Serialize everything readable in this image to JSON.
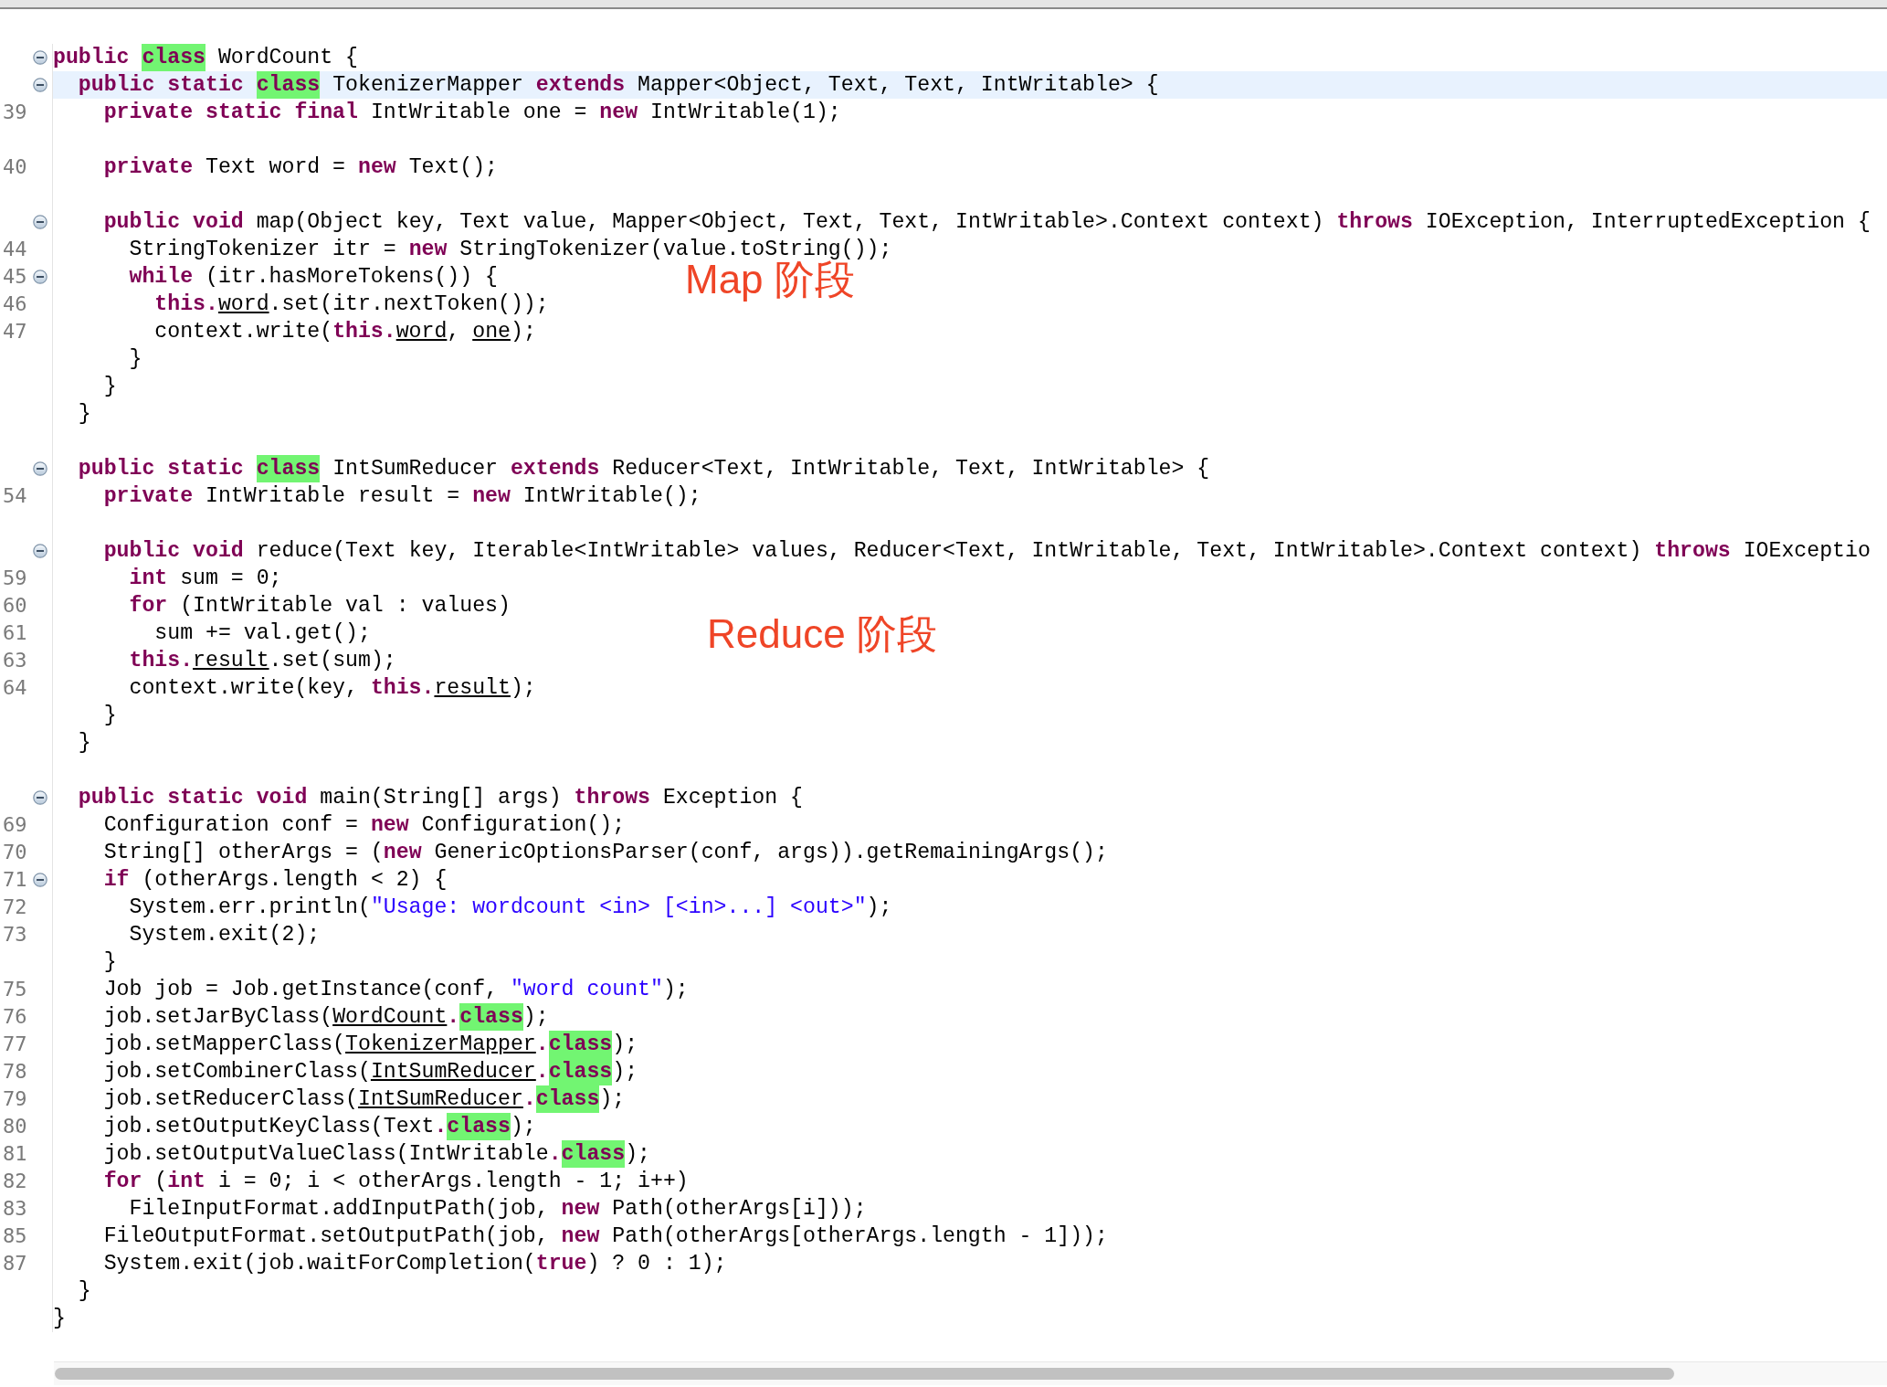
{
  "editor": {
    "lines": [
      {
        "kind": "code",
        "folding": true,
        "current": false,
        "tokens": [
          {
            "kind": "keyword",
            "text": "public "
          },
          {
            "kind": "match",
            "text": "class"
          },
          {
            "kind": "plain",
            "text": " WordCount {"
          }
        ]
      },
      {
        "kind": "code",
        "folding": true,
        "current": true,
        "tokens": [
          {
            "kind": "keyword",
            "text": "  public static "
          },
          {
            "kind": "match",
            "text": "class"
          },
          {
            "kind": "plain",
            "text": " TokenizerMapper "
          },
          {
            "kind": "keyword",
            "text": "extends"
          },
          {
            "kind": "plain",
            "text": " Mapper<Object, Text, Text, IntWritable> {"
          }
        ]
      },
      {
        "kind": "code",
        "number": "39",
        "folding": false,
        "current": false,
        "tokens": [
          {
            "kind": "keyword",
            "text": "    private static final"
          },
          {
            "kind": "plain",
            "text": " IntWritable one = "
          },
          {
            "kind": "keyword",
            "text": "new"
          },
          {
            "kind": "plain",
            "text": " IntWritable(1);"
          }
        ]
      },
      {
        "kind": "blank"
      },
      {
        "kind": "code",
        "number": "40",
        "folding": false,
        "current": false,
        "tokens": [
          {
            "kind": "keyword",
            "text": "    private"
          },
          {
            "kind": "plain",
            "text": " Text word = "
          },
          {
            "kind": "keyword",
            "text": "new"
          },
          {
            "kind": "plain",
            "text": " Text();"
          }
        ]
      },
      {
        "kind": "blank"
      },
      {
        "kind": "code",
        "folding": true,
        "current": false,
        "tokens": [
          {
            "kind": "keyword",
            "text": "    public void"
          },
          {
            "kind": "plain",
            "text": " map(Object key, Text value, Mapper<Object, Text, Text, IntWritable>.Context context) "
          },
          {
            "kind": "keyword",
            "text": "throws"
          },
          {
            "kind": "plain",
            "text": " IOException, InterruptedException {"
          }
        ]
      },
      {
        "kind": "code",
        "number": "44",
        "folding": false,
        "current": false,
        "tokens": [
          {
            "kind": "plain",
            "text": "      StringTokenizer itr = "
          },
          {
            "kind": "keyword",
            "text": "new"
          },
          {
            "kind": "plain",
            "text": " StringTokenizer(value.toString());"
          }
        ]
      },
      {
        "kind": "code",
        "number": "45",
        "folding": true,
        "current": false,
        "tokens": [
          {
            "kind": "keyword",
            "text": "      while"
          },
          {
            "kind": "plain",
            "text": " (itr.hasMoreTokens()) {"
          }
        ]
      },
      {
        "kind": "code",
        "number": "46",
        "folding": false,
        "current": false,
        "tokens": [
          {
            "kind": "keyword",
            "text": "        this."
          },
          {
            "kind": "ref",
            "text": "word"
          },
          {
            "kind": "plain",
            "text": ".set(itr.nextToken());"
          }
        ]
      },
      {
        "kind": "code",
        "number": "47",
        "folding": false,
        "current": false,
        "tokens": [
          {
            "kind": "plain",
            "text": "        context.write("
          },
          {
            "kind": "keyword",
            "text": "this."
          },
          {
            "kind": "ref",
            "text": "word"
          },
          {
            "kind": "plain",
            "text": ", "
          },
          {
            "kind": "ref",
            "text": "one"
          },
          {
            "kind": "plain",
            "text": ");"
          }
        ]
      },
      {
        "kind": "code",
        "folding": false,
        "current": false,
        "tokens": [
          {
            "kind": "plain",
            "text": "      }"
          }
        ]
      },
      {
        "kind": "code",
        "folding": false,
        "current": false,
        "tokens": [
          {
            "kind": "plain",
            "text": "    }"
          }
        ]
      },
      {
        "kind": "code",
        "folding": false,
        "current": false,
        "tokens": [
          {
            "kind": "plain",
            "text": "  }"
          }
        ]
      },
      {
        "kind": "blank"
      },
      {
        "kind": "code",
        "folding": true,
        "current": false,
        "tokens": [
          {
            "kind": "keyword",
            "text": "  public static "
          },
          {
            "kind": "match",
            "text": "class"
          },
          {
            "kind": "plain",
            "text": " IntSumReducer "
          },
          {
            "kind": "keyword",
            "text": "extends"
          },
          {
            "kind": "plain",
            "text": " Reducer<Text, IntWritable, Text, IntWritable> {"
          }
        ]
      },
      {
        "kind": "code",
        "number": "54",
        "folding": false,
        "current": false,
        "tokens": [
          {
            "kind": "keyword",
            "text": "    private"
          },
          {
            "kind": "plain",
            "text": " IntWritable result = "
          },
          {
            "kind": "keyword",
            "text": "new"
          },
          {
            "kind": "plain",
            "text": " IntWritable();"
          }
        ]
      },
      {
        "kind": "blank"
      },
      {
        "kind": "code",
        "folding": true,
        "current": false,
        "tokens": [
          {
            "kind": "keyword",
            "text": "    public void"
          },
          {
            "kind": "plain",
            "text": " reduce(Text key, Iterable<IntWritable> values, Reducer<Text, IntWritable, Text, IntWritable>.Context context) "
          },
          {
            "kind": "keyword",
            "text": "throws"
          },
          {
            "kind": "plain",
            "text": " IOExceptio"
          }
        ]
      },
      {
        "kind": "code",
        "number": "59",
        "folding": false,
        "current": false,
        "tokens": [
          {
            "kind": "keyword",
            "text": "      int"
          },
          {
            "kind": "plain",
            "text": " sum = 0;"
          }
        ]
      },
      {
        "kind": "code",
        "number": "60",
        "folding": false,
        "current": false,
        "tokens": [
          {
            "kind": "keyword",
            "text": "      for"
          },
          {
            "kind": "plain",
            "text": " (IntWritable val : values)"
          }
        ]
      },
      {
        "kind": "code",
        "number": "61",
        "folding": false,
        "current": false,
        "tokens": [
          {
            "kind": "plain",
            "text": "        sum += val.get();"
          }
        ]
      },
      {
        "kind": "code",
        "number": "63",
        "folding": false,
        "current": false,
        "tokens": [
          {
            "kind": "keyword",
            "text": "      this."
          },
          {
            "kind": "ref",
            "text": "result"
          },
          {
            "kind": "plain",
            "text": ".set(sum);"
          }
        ]
      },
      {
        "kind": "code",
        "number": "64",
        "folding": false,
        "current": false,
        "tokens": [
          {
            "kind": "plain",
            "text": "      context.write(key, "
          },
          {
            "kind": "keyword",
            "text": "this."
          },
          {
            "kind": "ref",
            "text": "result"
          },
          {
            "kind": "plain",
            "text": ");"
          }
        ]
      },
      {
        "kind": "code",
        "folding": false,
        "current": false,
        "tokens": [
          {
            "kind": "plain",
            "text": "    }"
          }
        ]
      },
      {
        "kind": "code",
        "folding": false,
        "current": false,
        "tokens": [
          {
            "kind": "plain",
            "text": "  }"
          }
        ]
      },
      {
        "kind": "blank"
      },
      {
        "kind": "code",
        "folding": true,
        "current": false,
        "tokens": [
          {
            "kind": "keyword",
            "text": "  public static void"
          },
          {
            "kind": "plain",
            "text": " main(String[] args) "
          },
          {
            "kind": "keyword",
            "text": "throws"
          },
          {
            "kind": "plain",
            "text": " Exception {"
          }
        ]
      },
      {
        "kind": "code",
        "number": "69",
        "folding": false,
        "current": false,
        "tokens": [
          {
            "kind": "plain",
            "text": "    Configuration conf = "
          },
          {
            "kind": "keyword",
            "text": "new"
          },
          {
            "kind": "plain",
            "text": " Configuration();"
          }
        ]
      },
      {
        "kind": "code",
        "number": "70",
        "folding": false,
        "current": false,
        "tokens": [
          {
            "kind": "plain",
            "text": "    String[] otherArgs = ("
          },
          {
            "kind": "keyword",
            "text": "new"
          },
          {
            "kind": "plain",
            "text": " GenericOptionsParser(conf, args)).getRemainingArgs();"
          }
        ]
      },
      {
        "kind": "code",
        "number": "71",
        "folding": true,
        "current": false,
        "tokens": [
          {
            "kind": "keyword",
            "text": "    if"
          },
          {
            "kind": "plain",
            "text": " (otherArgs.length < 2) {"
          }
        ]
      },
      {
        "kind": "code",
        "number": "72",
        "folding": false,
        "current": false,
        "tokens": [
          {
            "kind": "plain",
            "text": "      System.err.println("
          },
          {
            "kind": "string",
            "text": "\"Usage: wordcount <in> [<in>...] <out>\""
          },
          {
            "kind": "plain",
            "text": ");"
          }
        ]
      },
      {
        "kind": "code",
        "number": "73",
        "folding": false,
        "current": false,
        "tokens": [
          {
            "kind": "plain",
            "text": "      System.exit(2);"
          }
        ]
      },
      {
        "kind": "code",
        "folding": false,
        "current": false,
        "tokens": [
          {
            "kind": "plain",
            "text": "    }"
          }
        ]
      },
      {
        "kind": "code",
        "number": "75",
        "folding": false,
        "current": false,
        "tokens": [
          {
            "kind": "plain",
            "text": "    Job job = Job.getInstance(conf, "
          },
          {
            "kind": "string",
            "text": "\"word count\""
          },
          {
            "kind": "plain",
            "text": ");"
          }
        ]
      },
      {
        "kind": "code",
        "number": "76",
        "folding": false,
        "current": false,
        "tokens": [
          {
            "kind": "plain",
            "text": "    job.setJarByClass("
          },
          {
            "kind": "ref",
            "text": "WordCount"
          },
          {
            "kind": "member_match",
            "text": ".class"
          },
          {
            "kind": "plain",
            "text": ");"
          }
        ]
      },
      {
        "kind": "code",
        "number": "77",
        "folding": false,
        "current": false,
        "tokens": [
          {
            "kind": "plain",
            "text": "    job.setMapperClass("
          },
          {
            "kind": "ref",
            "text": "TokenizerMapper"
          },
          {
            "kind": "member_match",
            "text": ".class"
          },
          {
            "kind": "plain",
            "text": ");"
          }
        ]
      },
      {
        "kind": "code",
        "number": "78",
        "folding": false,
        "current": false,
        "tokens": [
          {
            "kind": "plain",
            "text": "    job.setCombinerClass("
          },
          {
            "kind": "ref",
            "text": "IntSumReducer"
          },
          {
            "kind": "member_match",
            "text": ".class"
          },
          {
            "kind": "plain",
            "text": ");"
          }
        ]
      },
      {
        "kind": "code",
        "number": "79",
        "folding": false,
        "current": false,
        "tokens": [
          {
            "kind": "plain",
            "text": "    job.setReducerClass("
          },
          {
            "kind": "ref",
            "text": "IntSumReducer"
          },
          {
            "kind": "member_match",
            "text": ".class"
          },
          {
            "kind": "plain",
            "text": ");"
          }
        ]
      },
      {
        "kind": "code",
        "number": "80",
        "folding": false,
        "current": false,
        "tokens": [
          {
            "kind": "plain",
            "text": "    job.setOutputKeyClass(Text"
          },
          {
            "kind": "member_match",
            "text": ".class"
          },
          {
            "kind": "plain",
            "text": ");"
          }
        ]
      },
      {
        "kind": "code",
        "number": "81",
        "folding": false,
        "current": false,
        "tokens": [
          {
            "kind": "plain",
            "text": "    job.setOutputValueClass(IntWritable"
          },
          {
            "kind": "member_match",
            "text": ".class"
          },
          {
            "kind": "plain",
            "text": ");"
          }
        ]
      },
      {
        "kind": "code",
        "number": "82",
        "folding": false,
        "current": false,
        "tokens": [
          {
            "kind": "keyword",
            "text": "    for"
          },
          {
            "kind": "plain",
            "text": " ("
          },
          {
            "kind": "keyword",
            "text": "int"
          },
          {
            "kind": "plain",
            "text": " i = 0; i < otherArgs.length - 1; i++)"
          }
        ]
      },
      {
        "kind": "code",
        "number": "83",
        "folding": false,
        "current": false,
        "tokens": [
          {
            "kind": "plain",
            "text": "      FileInputFormat.addInputPath(job, "
          },
          {
            "kind": "keyword",
            "text": "new"
          },
          {
            "kind": "plain",
            "text": " Path(otherArgs[i]));"
          }
        ]
      },
      {
        "kind": "code",
        "number": "85",
        "folding": false,
        "current": false,
        "tokens": [
          {
            "kind": "plain",
            "text": "    FileOutputFormat.setOutputPath(job, "
          },
          {
            "kind": "keyword",
            "text": "new"
          },
          {
            "kind": "plain",
            "text": " Path(otherArgs[otherArgs.length - 1]));"
          }
        ]
      },
      {
        "kind": "code",
        "number": "87",
        "folding": false,
        "current": false,
        "tokens": [
          {
            "kind": "plain",
            "text": "    System.exit(job.waitForCompletion("
          },
          {
            "kind": "keyword",
            "text": "true"
          },
          {
            "kind": "plain",
            "text": ") ? 0 : 1);"
          }
        ]
      },
      {
        "kind": "code",
        "folding": false,
        "current": false,
        "tokens": [
          {
            "kind": "plain",
            "text": "  }"
          }
        ]
      },
      {
        "kind": "code",
        "folding": false,
        "current": false,
        "tokens": [
          {
            "kind": "plain",
            "text": "}"
          }
        ]
      }
    ]
  },
  "annotations": [
    {
      "text": "Map 阶段"
    },
    {
      "text": "Reduce 阶段"
    }
  ]
}
